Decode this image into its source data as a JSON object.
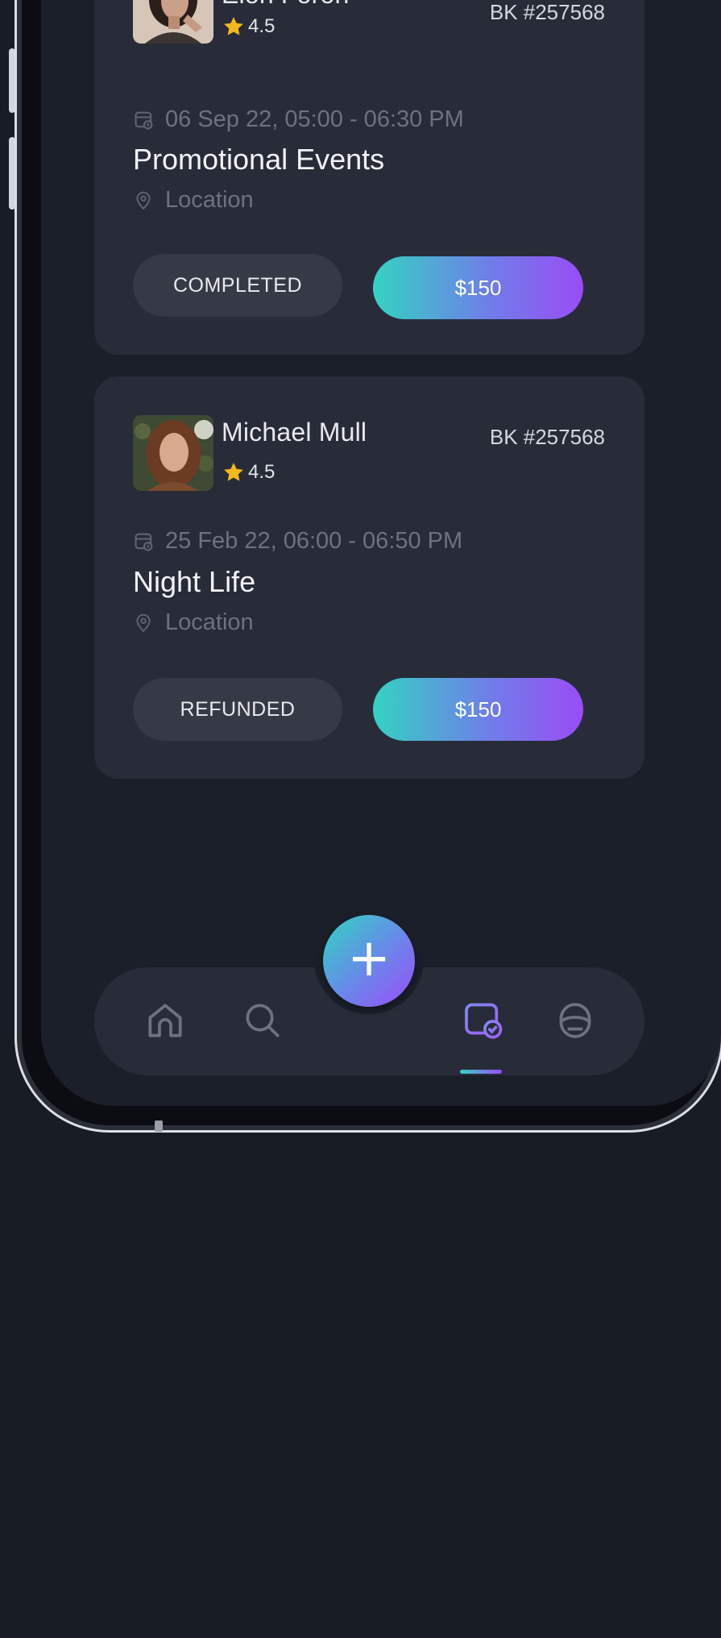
{
  "bookings": [
    {
      "name": "Elon Foron",
      "rating": "4.5",
      "booking_id": "BK #257568",
      "datetime": "06 Sep 22, 05:00 - 06:30 PM",
      "title": "Promotional Events",
      "location": "Location",
      "status": "COMPLETED",
      "price": "$150"
    },
    {
      "name": "Michael Mull",
      "rating": "4.5",
      "booking_id": "BK #257568",
      "datetime": "25 Feb 22, 06:00 - 06:50 PM",
      "title": "Night Life",
      "location": "Location",
      "status": "REFUNDED",
      "price": "$150"
    }
  ],
  "nav": {
    "active": "bookings",
    "items": [
      "home-icon",
      "search-icon",
      "calendar-check-icon",
      "profile-icon"
    ],
    "fab_symbol": "+"
  },
  "colors": {
    "background": "#181c25",
    "card": "#282c38",
    "accent_start": "#33d3c2",
    "accent_end": "#9a4cf6",
    "star": "#f5b81c"
  }
}
